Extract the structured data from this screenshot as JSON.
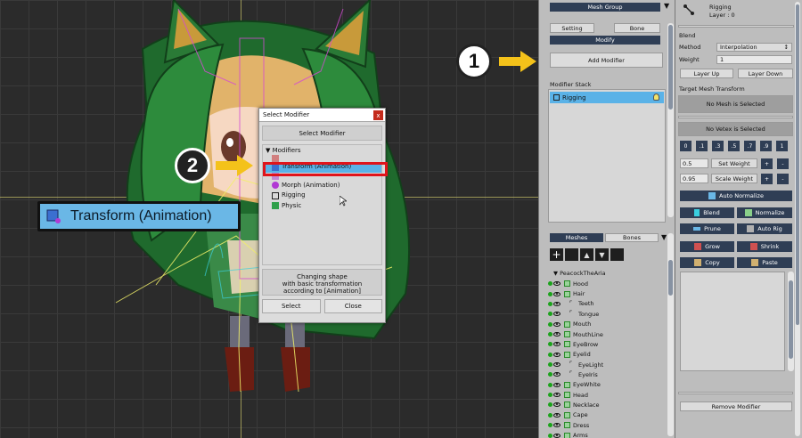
{
  "step_markers": [
    "1",
    "2"
  ],
  "transform_label": "Transform (Animation)",
  "dialog": {
    "title": "Select Modifier",
    "close": "x",
    "header": "Select Modifier",
    "tree_root": "Modifiers",
    "items": [
      "Transform (Animation)",
      "Morph (Animation)",
      "Rigging",
      "Physic"
    ],
    "description": [
      "Changing shape",
      "with basic transformation",
      "according to [Animation]"
    ],
    "select_button": "Select",
    "close_button": "Close"
  },
  "mid_panel": {
    "top_button": "Mesh Group",
    "tab_setting": "Setting",
    "tab_bone": "Bone",
    "modify": "Modify",
    "add_modifier": "Add Modifier",
    "modifier_stack_label": "Modifier Stack",
    "stack_items": [
      "Rigging"
    ],
    "tab_meshes": "Meshes",
    "tab_bones": "Bones",
    "root": "PeacockTheAria",
    "meshes": [
      {
        "name": "Hood",
        "kind": "mesh"
      },
      {
        "name": "Hair",
        "kind": "mesh"
      },
      {
        "name": "Teeth",
        "kind": "bone"
      },
      {
        "name": "Tongue",
        "kind": "bone"
      },
      {
        "name": "Mouth",
        "kind": "mesh"
      },
      {
        "name": "MouthLine",
        "kind": "mesh"
      },
      {
        "name": "EyeBrow",
        "kind": "mesh"
      },
      {
        "name": "Eyelid",
        "kind": "mesh"
      },
      {
        "name": "EyeLight",
        "kind": "bone"
      },
      {
        "name": "EyeIris",
        "kind": "bone"
      },
      {
        "name": "EyeWhite",
        "kind": "mesh"
      },
      {
        "name": "Head",
        "kind": "mesh"
      },
      {
        "name": "Necklace",
        "kind": "mesh"
      },
      {
        "name": "Cape",
        "kind": "mesh"
      },
      {
        "name": "Dress",
        "kind": "mesh"
      },
      {
        "name": "Arms",
        "kind": "mesh"
      }
    ]
  },
  "right_panel": {
    "title": "Rigging",
    "subtitle": "Layer : 0",
    "blend": "Blend",
    "method_label": "Method",
    "method_value": "Interpolation",
    "weight_label": "Weight",
    "weight_value": "1",
    "layer_up": "Layer Up",
    "layer_down": "Layer Down",
    "target_label": "Target Mesh Transform",
    "no_mesh": "No Mesh is Selected",
    "no_vertex": "No Vetex is Selected",
    "weights": [
      "0",
      ".1",
      ".3",
      ".5",
      ".7",
      ".9",
      "1"
    ],
    "set_value": "0.5",
    "set_weight": "Set Weight",
    "scale_value": "0.95",
    "scale_weight": "Scale Weight",
    "plus": "+",
    "minus": "-",
    "auto_normalize": "Auto Normalize",
    "blend_btn": "Blend",
    "normalize": "Normalize",
    "prune": "Prune",
    "auto_rig": "Auto Rig",
    "grow": "Grow",
    "shrink": "Shrink",
    "copy": "Copy",
    "paste": "Paste",
    "remove_modifier": "Remove Modifier"
  }
}
